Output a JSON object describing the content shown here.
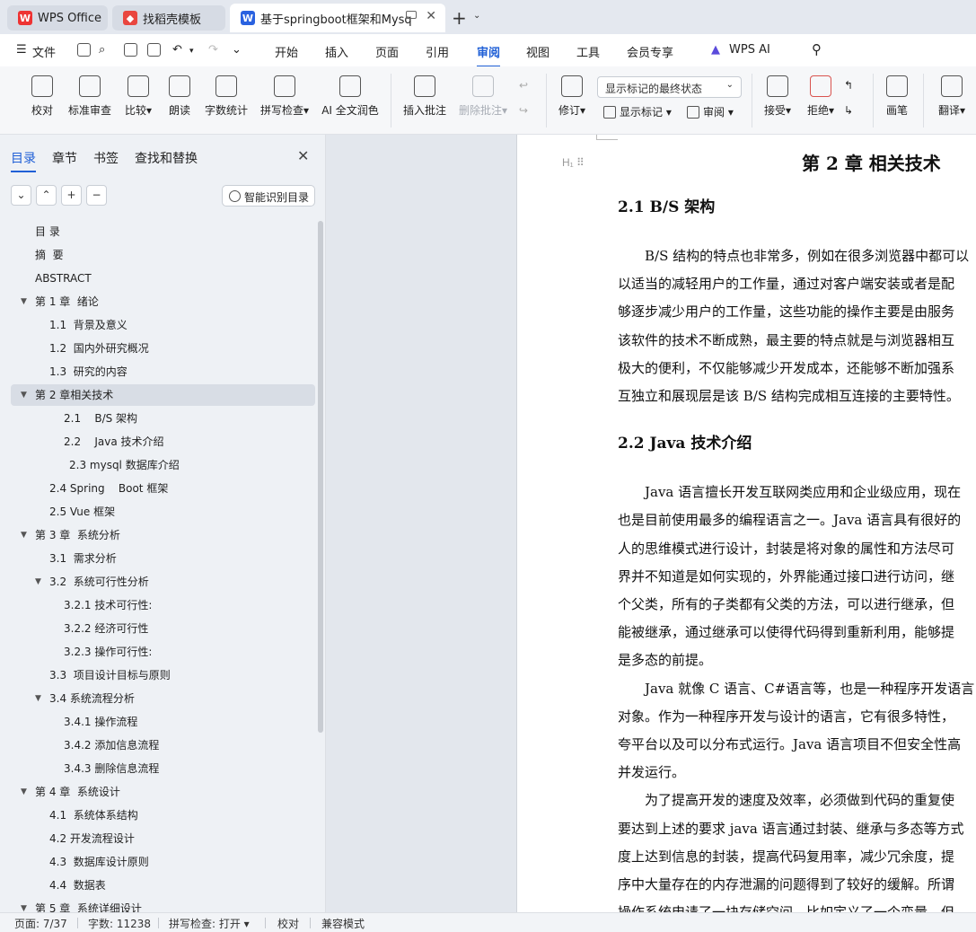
{
  "tabs": {
    "wps_office": "WPS Office",
    "template": "找稻壳模板",
    "document": "基于springboot框架和Mysq"
  },
  "menu": {
    "file": "文件",
    "items": [
      "开始",
      "插入",
      "页面",
      "引用",
      "审阅",
      "视图",
      "工具",
      "会员专享"
    ],
    "active": "审阅",
    "wps_ai": "WPS AI"
  },
  "ribbon": {
    "proofread": "校对",
    "standard_review": "标准审查",
    "compare": "比较",
    "read_aloud": "朗读",
    "word_count": "字数统计",
    "spell_check": "拼写检查",
    "ai_polish": "AI 全文润色",
    "insert_comment": "插入批注",
    "delete_comment": "删除批注",
    "track_changes": "修订",
    "markup_select": "显示标记的最终状态",
    "show_markup": "显示标记",
    "review": "审阅",
    "accept": "接受",
    "reject": "拒绝",
    "pen": "画笔",
    "translate": "翻译"
  },
  "nav": {
    "tabs": [
      "目录",
      "章节",
      "书签",
      "查找和替换"
    ],
    "active_tab": "目录",
    "smart_toc": "智能识别目录",
    "toc": [
      {
        "label": "目 录",
        "level": 1,
        "twisty": ""
      },
      {
        "label": "摘  要",
        "level": 1,
        "twisty": ""
      },
      {
        "label": "ABSTRACT",
        "level": 1,
        "twisty": ""
      },
      {
        "label": "第 1 章  绪论",
        "level": 1,
        "twisty": "▼"
      },
      {
        "label": "1.1  背景及意义",
        "level": 2,
        "twisty": ""
      },
      {
        "label": "1.2  国内外研究概况",
        "level": 2,
        "twisty": ""
      },
      {
        "label": "1.3  研究的内容",
        "level": 2,
        "twisty": ""
      },
      {
        "label": "第 2 章相关技术",
        "level": 1,
        "twisty": "▼",
        "selected": true
      },
      {
        "label": "2.1    B/S 架构",
        "level": 3,
        "twisty": ""
      },
      {
        "label": "2.2    Java 技术介绍",
        "level": 3,
        "twisty": ""
      },
      {
        "label": "2.3 mysql 数据库介绍",
        "level": 3.4,
        "twisty": ""
      },
      {
        "label": "2.4 Spring    Boot 框架",
        "level": 2,
        "twisty": ""
      },
      {
        "label": "2.5 Vue 框架",
        "level": 2,
        "twisty": ""
      },
      {
        "label": "第 3 章  系统分析",
        "level": 1,
        "twisty": "▼"
      },
      {
        "label": "3.1  需求分析",
        "level": 2,
        "twisty": ""
      },
      {
        "label": "3.2  系统可行性分析",
        "level": 2,
        "twisty": "▼"
      },
      {
        "label": "3.2.1 技术可行性:",
        "level": 3,
        "twisty": ""
      },
      {
        "label": "3.2.2 经济可行性",
        "level": 3,
        "twisty": ""
      },
      {
        "label": "3.2.3 操作可行性:",
        "level": 3,
        "twisty": ""
      },
      {
        "label": "3.3  项目设计目标与原则",
        "level": 2,
        "twisty": ""
      },
      {
        "label": "3.4 系统流程分析",
        "level": 2,
        "twisty": "▼"
      },
      {
        "label": "3.4.1 操作流程",
        "level": 3,
        "twisty": ""
      },
      {
        "label": "3.4.2 添加信息流程",
        "level": 3,
        "twisty": ""
      },
      {
        "label": "3.4.3 删除信息流程",
        "level": 3,
        "twisty": ""
      },
      {
        "label": "第 4 章  系统设计",
        "level": 1,
        "twisty": "▼"
      },
      {
        "label": "4.1  系统体系结构",
        "level": 2,
        "twisty": ""
      },
      {
        "label": "4.2 开发流程设计",
        "level": 2,
        "twisty": ""
      },
      {
        "label": "4.3  数据库设计原则",
        "level": 2,
        "twisty": ""
      },
      {
        "label": "4.4  数据表",
        "level": 2,
        "twisty": ""
      },
      {
        "label": "第 5 章  系统详细设计",
        "level": 1,
        "twisty": "▼"
      }
    ]
  },
  "document": {
    "chapter_title": "第 2 章  相关技术",
    "h_marker": "H₁",
    "sections": [
      {
        "heading": "2.1   B/S 架构",
        "lines": [
          "　　B/S 结构的特点也非常多，例如在很多浏览器中都可以",
          "以适当的减轻用户的工作量，通过对客户端安装或者是配",
          "够逐步减少用户的工作量，这些功能的操作主要是由服务",
          "该软件的技术不断成熟，最主要的特点就是与浏览器相互",
          "极大的便利，不仅能够减少开发成本，还能够不断加强系",
          "互独立和展现层是该 B/S 结构完成相互连接的主要特性。"
        ]
      },
      {
        "heading": "2.2   Java 技术介绍",
        "lines": [
          "　　Java 语言擅长开发互联网类应用和企业级应用，现在",
          "也是目前使用最多的编程语言之一。Java 语言具有很好的",
          "人的思维模式进行设计，封装是将对象的属性和方法尽可",
          "界并不知道是如何实现的，外界能通过接口进行访问，继",
          "个父类，所有的子类都有父类的方法，可以进行继承，但",
          "能被继承，通过继承可以使得代码得到重新利用，能够提",
          "是多态的前提。",
          "　　Java 就像 C 语言、C#语言等，也是一种程序开发语言",
          "对象。作为一种程序开发与设计的语言，它有很多特性，",
          "夸平台以及可以分布式运行。Java 语言项目不但安全性高",
          "并发运行。",
          "　　为了提高开发的速度及效率，必须做到代码的重复使",
          "要达到上述的要求 java 语言通过封装、继承与多态等方式",
          "度上达到信息的封装，提高代码复用率，减少冗余度，提",
          "序中大量存在的内存泄漏的问题得到了较好的缓解。所谓",
          "操作系统申请了一块存储空间，比如定义了一个变量，但"
        ]
      }
    ]
  },
  "status": {
    "page": "页面: 7/37",
    "words": "字数: 11238",
    "spell": "拼写检查: 打开",
    "proofread": "校对",
    "compat": "兼容模式"
  }
}
